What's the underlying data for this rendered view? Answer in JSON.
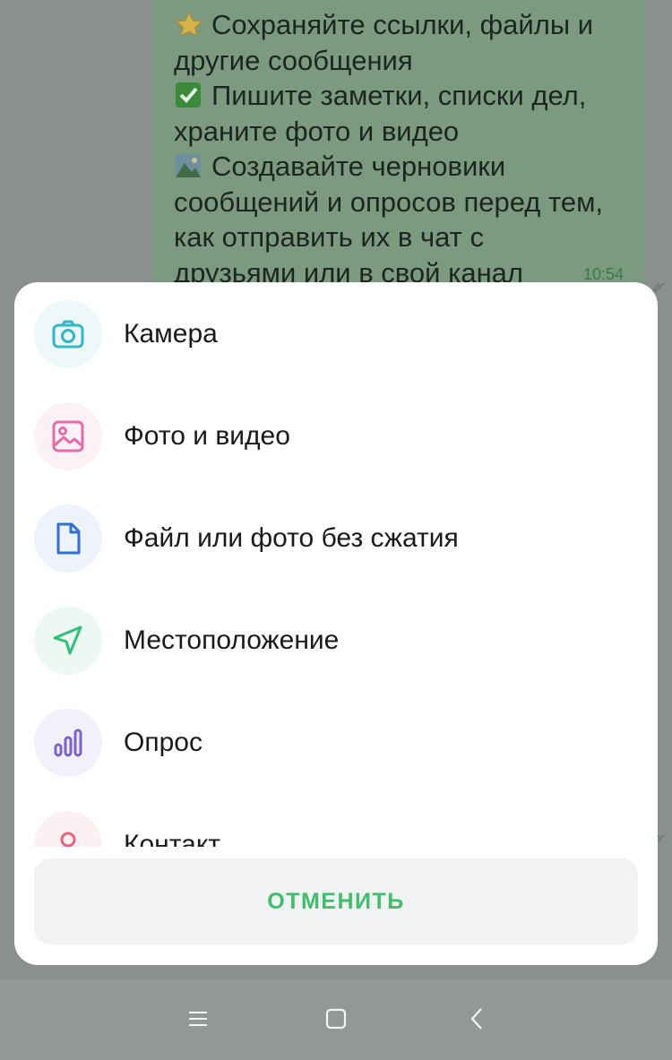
{
  "chat": {
    "message_lines": [
      "Сохраняйте ссылки, файлы и",
      "другие сообщения",
      "Пишите заметки, списки дел,",
      "храните фото и видео",
      "Создавайте черновики",
      "сообщений и опросов перед тем,",
      "как отправить их в чат с",
      "друзьями или в свой канал"
    ],
    "emoji_icons": [
      "star-icon",
      "check-box-icon",
      "landscape-picture-icon"
    ],
    "time": "10:54"
  },
  "sheet": {
    "items": [
      {
        "label": "Камера",
        "icon": "camera-icon",
        "color": "#2fb8c9",
        "bg": "#eef8f9"
      },
      {
        "label": "Фото и видео",
        "icon": "image-icon",
        "color": "#e86aa8",
        "bg": "#fcf1f5"
      },
      {
        "label": "Файл или фото без сжатия",
        "icon": "file-icon",
        "color": "#2f6fd6",
        "bg": "#eef3fb"
      },
      {
        "label": "Местоположение",
        "icon": "location-arrow-icon",
        "color": "#2fbf7a",
        "bg": "#eef8f3"
      },
      {
        "label": "Опрос",
        "icon": "poll-icon",
        "color": "#7b62d4",
        "bg": "#f2f0fb"
      },
      {
        "label": "Контакт",
        "icon": "contact-icon",
        "color": "#e8637c",
        "bg": "#fcf0f2"
      }
    ],
    "cancel_label": "ОТМЕНИТЬ",
    "accent_color": "#3fbf6a"
  },
  "navbar": {
    "icons": [
      "menu-icon",
      "home-square-icon",
      "back-icon"
    ]
  }
}
